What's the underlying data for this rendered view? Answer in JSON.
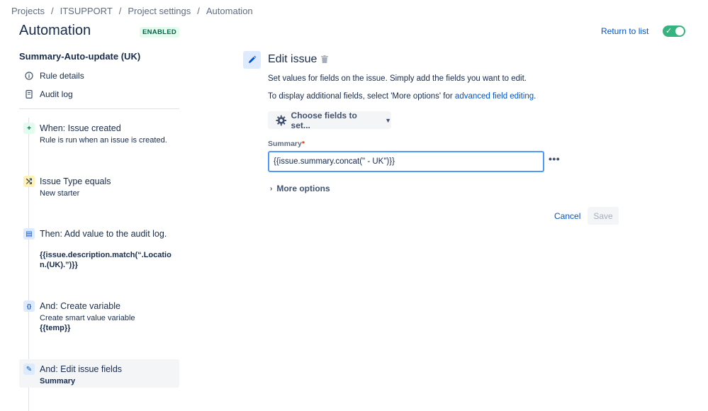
{
  "breadcrumb": [
    "Projects",
    "ITSUPPORT",
    "Project settings",
    "Automation"
  ],
  "breadcrumb_sep": "/",
  "header": {
    "title": "Automation",
    "status_badge": "ENABLED",
    "return_link": "Return to list",
    "toggle_on": true
  },
  "sidebar": {
    "rule_name": "Summary-Auto-update (UK)",
    "nav": [
      {
        "label": "Rule details",
        "icon": "info-icon"
      },
      {
        "label": "Audit log",
        "icon": "document-icon"
      }
    ],
    "steps": [
      {
        "badge": "+",
        "title": "When: Issue created",
        "sub": "Rule is run when an issue is created.",
        "sub_bold": false,
        "icon": "plus-icon",
        "color": "#e3fcef",
        "icon_color": "#006644"
      },
      {
        "badge": "⤭",
        "title": "Issue Type equals",
        "sub": "New starter",
        "sub_bold": false,
        "icon": "shuffle-icon",
        "color": "#fff0b3",
        "icon_color": "#172b4d"
      },
      {
        "badge": "▤",
        "title": "Then: Add value to the audit log.",
        "sub": "{{issue.description.match(“.Location.(UK).”)}}",
        "sub_bold": true,
        "icon": "audit-document-icon",
        "color": "#deebff",
        "icon_color": "#0052cc"
      },
      {
        "badge": "{}",
        "title": "And: Create variable",
        "sub": "Create smart value variable",
        "sub2": "{{temp}}",
        "sub_bold": false,
        "icon": "braces-icon",
        "color": "#deebff",
        "icon_color": "#0052cc"
      },
      {
        "badge": "✎",
        "title": "And: Edit issue fields",
        "sub": "Summary",
        "sub_bold": true,
        "icon": "pencil-icon",
        "color": "#deebff",
        "icon_color": "#0052cc"
      }
    ]
  },
  "editor": {
    "title": "Edit issue",
    "desc1": "Set values for fields on the issue. Simply add the fields you want to edit.",
    "desc2_prefix": "To display additional fields, select 'More options' for ",
    "desc2_link": "advanced field editing",
    "desc2_suffix": ".",
    "choose_fields": "Choose fields to set...",
    "field_label": "Summary",
    "field_required": "*",
    "field_value": "{{issue.summary.concat(\" - UK\")}}",
    "more_options": "More options",
    "cancel": "Cancel",
    "save": "Save"
  },
  "colors": {
    "accent": "#0052cc",
    "toggle": "#36b37e",
    "focus": "#4c9aff"
  }
}
